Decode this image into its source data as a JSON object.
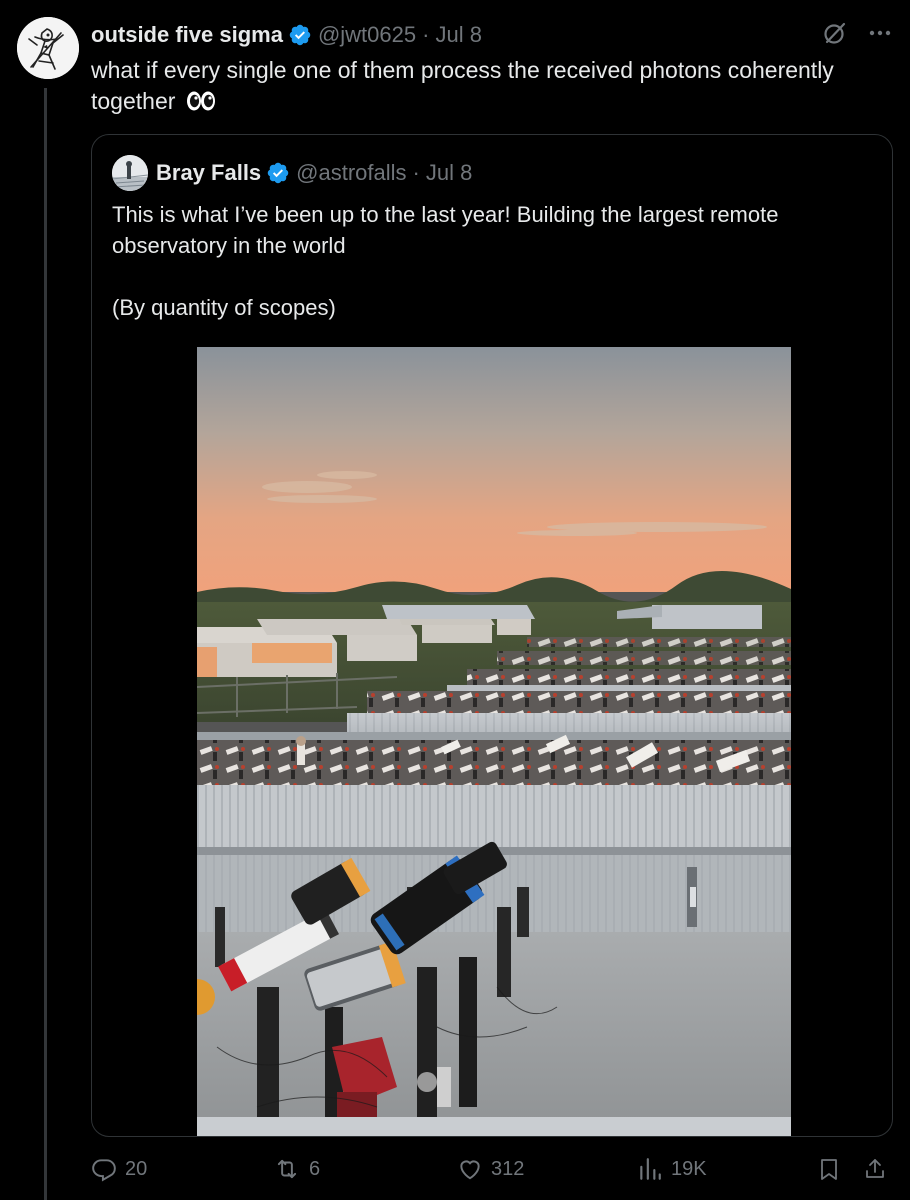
{
  "tweet": {
    "author": {
      "display_name": "outside five sigma",
      "handle": "@jwt0625",
      "avatar_icon": "sketch-avatar-icon",
      "verified": true
    },
    "date": "Jul 8",
    "separator": "·",
    "text": "what if every single one of them process the received photons coherently together",
    "emoji_icon": "eyes-icon"
  },
  "quoted": {
    "author": {
      "display_name": "Bray Falls",
      "handle": "@astrofalls",
      "verified": true
    },
    "date": "Jul 8",
    "separator": "·",
    "paragraphs": [
      "This is what I’ve been up to the last year! Building the largest remote observatory in the world",
      "(By quantity of scopes)"
    ],
    "media": {
      "kind": "photo",
      "icon": "observatory-telescopes-photo"
    }
  },
  "actions": {
    "replies": "20",
    "reposts": "6",
    "likes": "312",
    "views": "19K"
  },
  "colors": {
    "background": "#000000",
    "text": "#e7e9ea",
    "muted": "#71767b",
    "verified": "#1d9bf0",
    "border": "#2f3336"
  }
}
